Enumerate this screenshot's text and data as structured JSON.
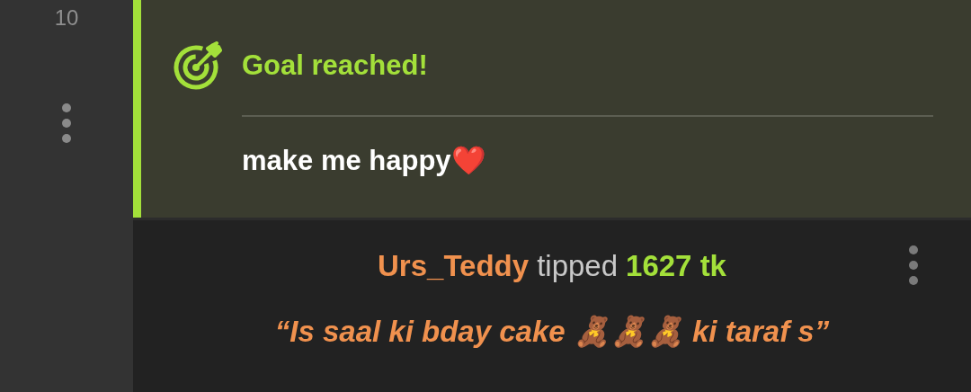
{
  "line_number": "10",
  "goal": {
    "title": "Goal reached!",
    "text": "make me happy❤️"
  },
  "tip": {
    "user": "Urs_Teddy",
    "verb": "tipped",
    "amount": "1627 tk",
    "message": "“Is saal ki bday cake 🧸🧸🧸 ki taraf s”"
  }
}
